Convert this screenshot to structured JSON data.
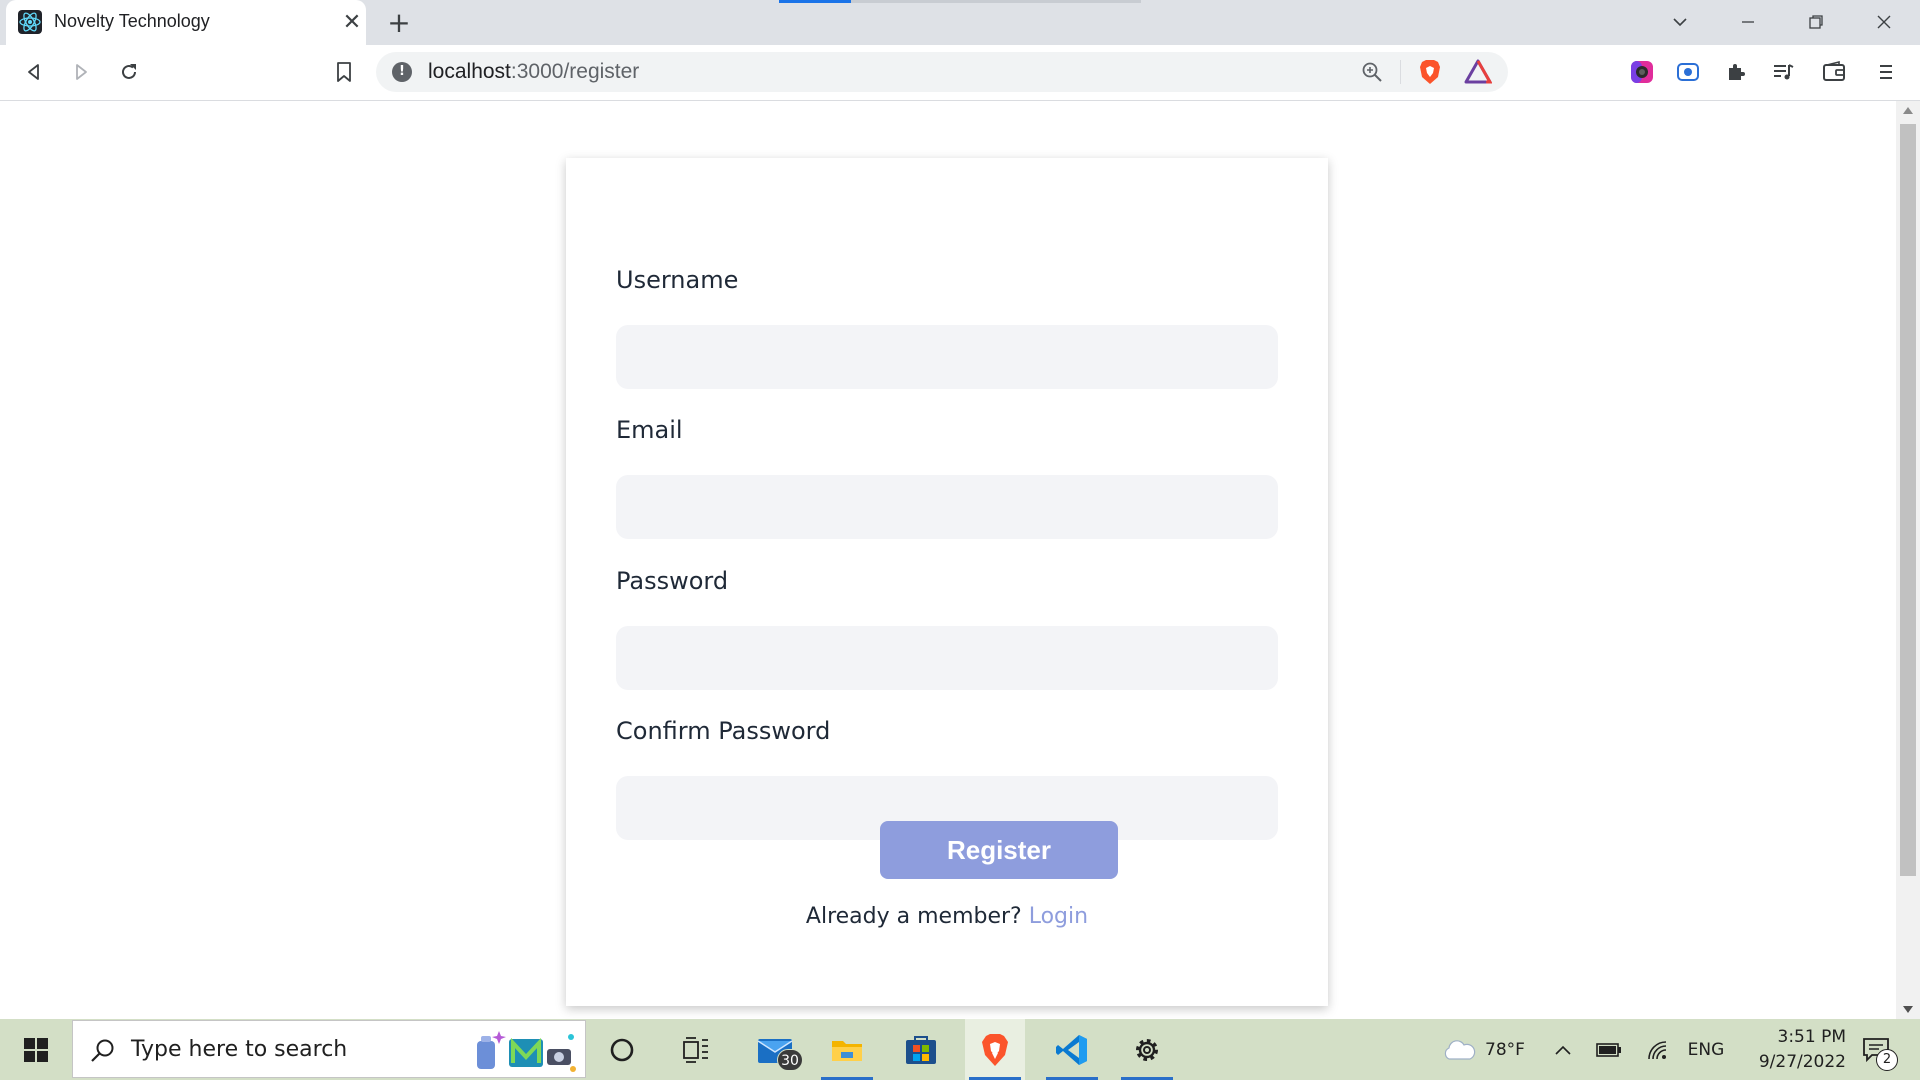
{
  "browser": {
    "tab_title": "Novelty Technology",
    "tab_close_glyph": "✕",
    "new_tab_glyph": "+",
    "url_host": "localhost",
    "url_path": ":3000/register",
    "favicon_icon": "react-icon",
    "accent_color": "#1a73e8"
  },
  "form": {
    "fields": [
      {
        "label": "Username",
        "value": "",
        "placeholder": ""
      },
      {
        "label": "Email",
        "value": "",
        "placeholder": ""
      },
      {
        "label": "Password",
        "value": "",
        "placeholder": ""
      },
      {
        "label": "Confirm Password",
        "value": "",
        "placeholder": ""
      }
    ],
    "submit_label": "Register",
    "member_prompt": "Already a member? ",
    "login_link": "Login",
    "button_color": "#8e9ddd",
    "input_background": "#f3f4f7"
  },
  "taskbar": {
    "search_placeholder": "Type here to search",
    "mail_badge": "30",
    "weather_temp": "78°F",
    "language": "ENG",
    "time": "3:51 PM",
    "date": "9/27/2022",
    "notification_count": "2",
    "background_color": "#d3dfc6"
  }
}
